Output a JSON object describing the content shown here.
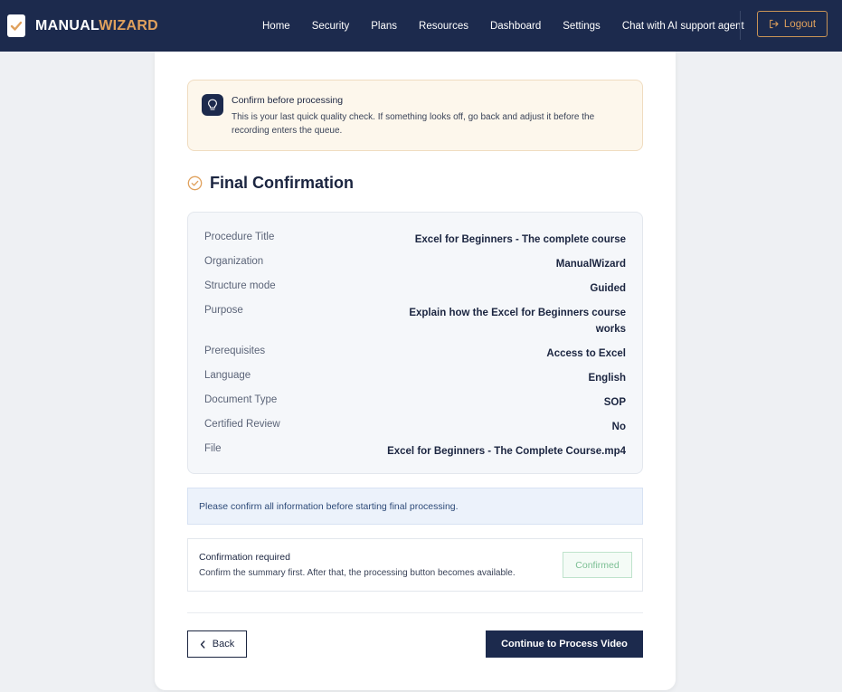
{
  "brand": {
    "name_part1": "MANUAL",
    "name_part2": "WIZARD",
    "logo_icon": "document-check-icon"
  },
  "nav": {
    "links": [
      "Home",
      "Security",
      "Plans",
      "Resources",
      "Dashboard",
      "Settings",
      "Chat with AI support agent"
    ],
    "logout_label": "Logout",
    "logout_icon": "logout-icon"
  },
  "notice": {
    "icon": "lightbulb-icon",
    "title": "Confirm before processing",
    "text": "This is your last quick quality check. If something looks off, go back and adjust it before the recording enters the queue."
  },
  "section": {
    "icon": "check-circle-icon",
    "title": "Final Confirmation"
  },
  "summary": {
    "rows": [
      {
        "label": "Procedure Title",
        "value": "Excel for Beginners - The complete course"
      },
      {
        "label": "Organization",
        "value": "ManualWizard"
      },
      {
        "label": "Structure mode",
        "value": "Guided"
      },
      {
        "label": "Purpose",
        "value": "Explain how the Excel for Beginners course works"
      },
      {
        "label": "Prerequisites",
        "value": "Access to Excel"
      },
      {
        "label": "Language",
        "value": "English"
      },
      {
        "label": "Document Type",
        "value": "SOP"
      },
      {
        "label": "Certified Review",
        "value": "No"
      },
      {
        "label": "File",
        "value": "Excel for Beginners - The Complete Course.mp4"
      }
    ]
  },
  "info_bar": {
    "text": "Please confirm all information before starting final processing."
  },
  "confirmation": {
    "title": "Confirmation required",
    "text": "Confirm the summary first. After that, the processing button becomes available.",
    "button_label": "Confirmed"
  },
  "actions": {
    "back_label": "Back",
    "process_label": "Continue to Process Video"
  },
  "colors": {
    "navy": "#1c2a4d",
    "accent": "#e0a15d",
    "success": "#7cbf94"
  }
}
